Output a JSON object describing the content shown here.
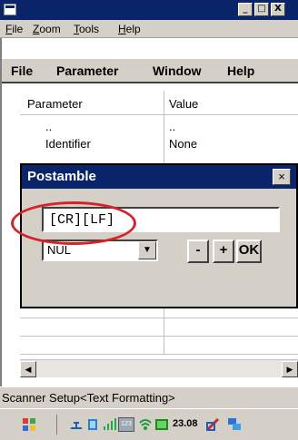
{
  "window": {
    "minimize": "_",
    "maximize": "□",
    "close": "X"
  },
  "menubar": {
    "items": [
      "File",
      "Zoom",
      "Tools",
      "Help"
    ]
  },
  "app_menu": {
    "items": [
      "File",
      "Parameter",
      "Window",
      "Help"
    ]
  },
  "grid": {
    "headers": [
      "Parameter",
      "Value"
    ],
    "rows": [
      {
        "parameter": "..",
        "value": ".."
      },
      {
        "parameter": "Identifier",
        "value": "None"
      }
    ]
  },
  "dialog": {
    "title": "Postamble",
    "close": "×",
    "text_value": "[CR][LF]",
    "select_value": "NUL",
    "minus": "-",
    "plus": "+",
    "ok": "OK"
  },
  "statusbar": {
    "text": "Scanner Setup<Text Formatting>"
  },
  "taskbar": {
    "time": "23.08",
    "badge": "123"
  },
  "colors": {
    "title": "#0a246a",
    "highlight": "#d6222a",
    "chrome": "#d4d0c8"
  }
}
